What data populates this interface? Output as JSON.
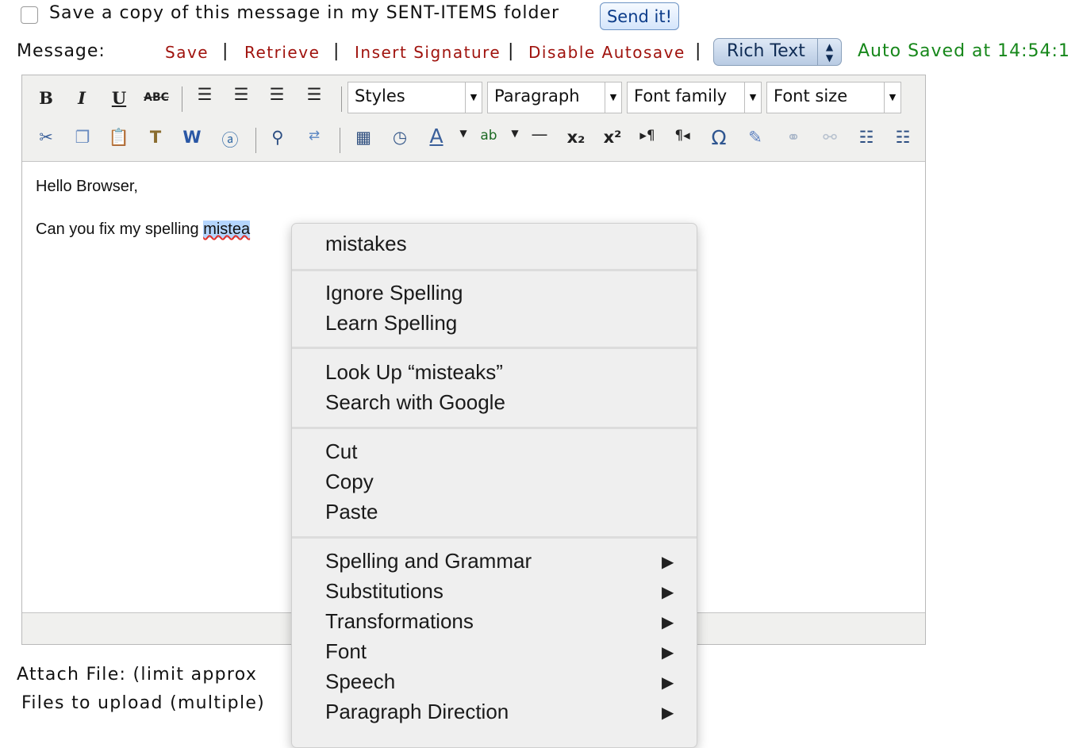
{
  "top": {
    "save_copy_label": "Save a copy of this message in my SENT-ITEMS folder",
    "send_button": "Send it!"
  },
  "message_row": {
    "label": "Message:",
    "links": [
      "Save",
      "Retrieve",
      "Insert Signature",
      "Disable Autosave"
    ],
    "separator": "|",
    "mode_select": "Rich Text",
    "autosave_status": "Auto Saved at 14:54:1"
  },
  "toolbar": {
    "row1_icons": [
      "bold-icon",
      "italic-icon",
      "underline-icon",
      "strikethrough-icon",
      "align-left-icon",
      "align-center-icon",
      "align-right-icon",
      "justify-icon"
    ],
    "dropdowns": [
      "Styles",
      "Paragraph",
      "Font family",
      "Font size"
    ],
    "row2_icons": [
      "cut-icon",
      "copy-icon",
      "paste-icon",
      "paste-text-icon",
      "paste-word-icon",
      "select-all-icon",
      "find-icon",
      "replace-icon",
      "insert-date-icon",
      "insert-time-icon",
      "text-color-icon",
      "highlight-icon",
      "horizontal-rule-icon",
      "subscript-icon",
      "superscript-icon",
      "ltr-icon",
      "rtl-icon",
      "special-char-icon",
      "edit-icon",
      "link-icon",
      "unlink-icon",
      "bullet-list-icon",
      "numbered-list-icon"
    ]
  },
  "editor": {
    "line1": "Hello Browser,",
    "line2_prefix": "Can you fix my spelling ",
    "line2_word": "mistea"
  },
  "context_menu": {
    "suggestion": "mistakes",
    "group1": [
      "Ignore Spelling",
      "Learn Spelling"
    ],
    "group2": [
      "Look Up “misteaks”",
      "Search with Google"
    ],
    "group3": [
      "Cut",
      "Copy",
      "Paste"
    ],
    "submenus": [
      "Spelling and Grammar",
      "Substitutions",
      "Transformations",
      "Font",
      "Speech",
      "Paragraph Direction"
    ],
    "submenu_arrow": "▶"
  },
  "bottom": {
    "attach_label": "Attach File: (limit approx",
    "files_label": "Files to upload (multiple)"
  }
}
